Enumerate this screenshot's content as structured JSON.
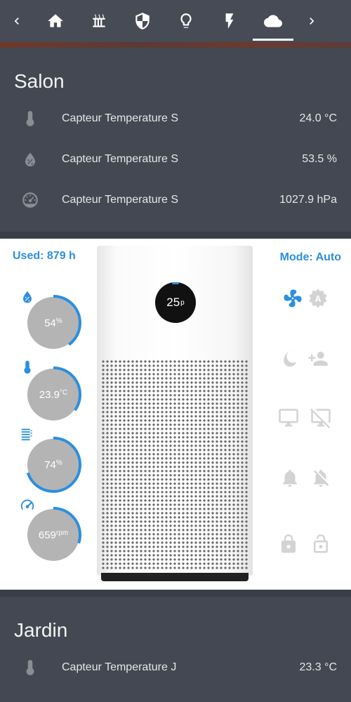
{
  "nav": {
    "prev_icon": "chevron-left-icon",
    "next_icon": "chevron-right-icon",
    "tabs": [
      {
        "icon": "home-icon"
      },
      {
        "icon": "radiator-icon"
      },
      {
        "icon": "shield-icon"
      },
      {
        "icon": "lightbulb-icon"
      },
      {
        "icon": "lightning-icon"
      },
      {
        "icon": "cloud-icon",
        "active": true
      }
    ]
  },
  "salon": {
    "title": "Salon",
    "rows": [
      {
        "icon": "thermometer-icon",
        "name": "Capteur Temperature S",
        "value": "24.0 °C"
      },
      {
        "icon": "water-percent-icon",
        "name": "Capteur Temperature S",
        "value": "53.5 %"
      },
      {
        "icon": "gauge-icon",
        "name": "Capteur Temperature S",
        "value": "1027.9 hPa"
      }
    ]
  },
  "purifier": {
    "used": "Used: 879 h",
    "mode": "Mode: Auto",
    "pm_value": "25",
    "pm_unit": "p",
    "accent": "#2b8fe0",
    "gauges": [
      {
        "icon": "water-percent-icon",
        "value": "54",
        "unit": "%",
        "level": 0.4
      },
      {
        "icon": "thermometer-icon",
        "value": "23.9",
        "unit": "°C",
        "level": 0.35
      },
      {
        "icon": "air-filter-icon",
        "value": "74",
        "unit": "%",
        "level": 0.7
      },
      {
        "icon": "speedometer-icon",
        "value": "659",
        "unit": "rpm",
        "level": 0.3
      }
    ],
    "controls": [
      {
        "icon": "fan-icon",
        "active": true
      },
      {
        "icon": "auto-mode-icon",
        "active": false
      },
      {
        "icon": "night-mode-icon",
        "active": false
      },
      {
        "icon": "favorite-user-icon",
        "active": false
      },
      {
        "icon": "monitor-icon",
        "active": false
      },
      {
        "icon": "monitor-off-icon",
        "active": false
      },
      {
        "icon": "bell-icon",
        "active": false
      },
      {
        "icon": "bell-off-icon",
        "active": false
      },
      {
        "icon": "lock-icon",
        "active": false
      },
      {
        "icon": "lock-open-icon",
        "active": false
      }
    ]
  },
  "jardin": {
    "title": "Jardin",
    "rows": [
      {
        "icon": "thermometer-icon",
        "name": "Capteur Temperature J",
        "value": "23.3 °C"
      }
    ]
  }
}
